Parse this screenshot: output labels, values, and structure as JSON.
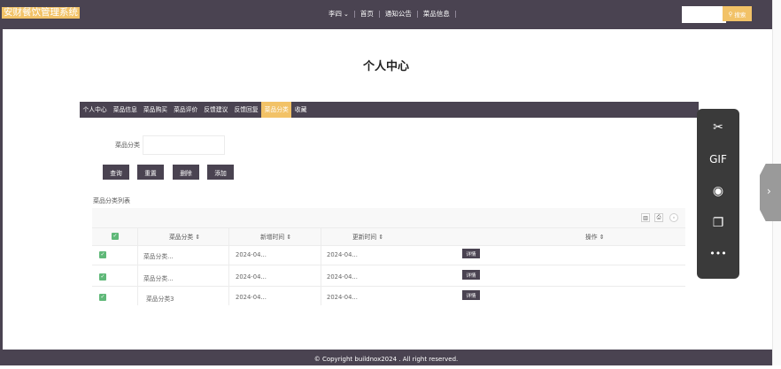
{
  "header": {
    "brand": "安财餐饮管理系统",
    "user": "李四",
    "nav_items": [
      "首页",
      "通知公告",
      "菜品信息"
    ],
    "search_placeholder": "",
    "search_button": "搜索"
  },
  "page_title": "个人中心",
  "tabs": [
    {
      "label": "个人中心",
      "active": false
    },
    {
      "label": "菜品信息",
      "active": false
    },
    {
      "label": "菜品购买",
      "active": false
    },
    {
      "label": "菜品评价",
      "active": false
    },
    {
      "label": "反馈建议",
      "active": false
    },
    {
      "label": "反馈回复",
      "active": false
    },
    {
      "label": "菜品分类",
      "active": true
    },
    {
      "label": "收藏",
      "active": false
    }
  ],
  "form": {
    "field_label": "菜品分类",
    "field_value": "",
    "buttons": [
      "查询",
      "重置",
      "删除",
      "添加"
    ]
  },
  "list": {
    "title": "菜品分类列表",
    "columns": [
      "菜品分类",
      "新增时间",
      "更新时间",
      "操作"
    ],
    "rows": [
      {
        "category": "菜品分类...",
        "created": "2024-04...",
        "updated": "2024-04...",
        "action": "详情"
      },
      {
        "category": "菜品分类...",
        "created": "2024-04...",
        "updated": "2024-04...",
        "action": "详情"
      },
      {
        "category": "菜品分类3",
        "created": "2024-04...",
        "updated": "2024-04...",
        "action": "详情"
      }
    ]
  },
  "footer": "© Copyright buildnox2024 . All right reserved.",
  "floating_toolbar": {
    "gif_label": "GIF",
    "more": "•••"
  },
  "colors": {
    "primary": "#4a4351",
    "accent": "#f2c267",
    "check": "#5fb878"
  }
}
